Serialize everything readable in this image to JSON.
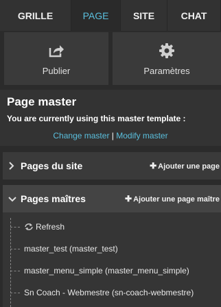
{
  "tabs": [
    {
      "label": "GRILLE",
      "active": false
    },
    {
      "label": "PAGE",
      "active": true
    },
    {
      "label": "SITE",
      "active": false
    },
    {
      "label": "CHAT",
      "active": false
    }
  ],
  "actions": [
    {
      "label": "Publier",
      "icon": "share-icon"
    },
    {
      "label": "Paramètres",
      "icon": "gear-icon"
    }
  ],
  "master": {
    "title": "Page master",
    "subtitle": "You are currently using this master template :",
    "change_link": "Change master",
    "separator": "|",
    "modify_link": "Modify master"
  },
  "sections": [
    {
      "title": "Pages du site",
      "add_label": "Ajouter une page",
      "expanded": false
    },
    {
      "title": "Pages maîtres",
      "add_label": "Ajouter une page maître",
      "expanded": true
    }
  ],
  "tree_items": [
    "Refresh",
    "master_test (master_test)",
    "master_menu_simple (master_menu_simple)",
    "Sn Coach - Webmestre (sn-coach-webmestre)"
  ],
  "colors": {
    "accent": "#5bc0de",
    "background": "#2b2b2b",
    "panel": "#3a3a3a"
  }
}
